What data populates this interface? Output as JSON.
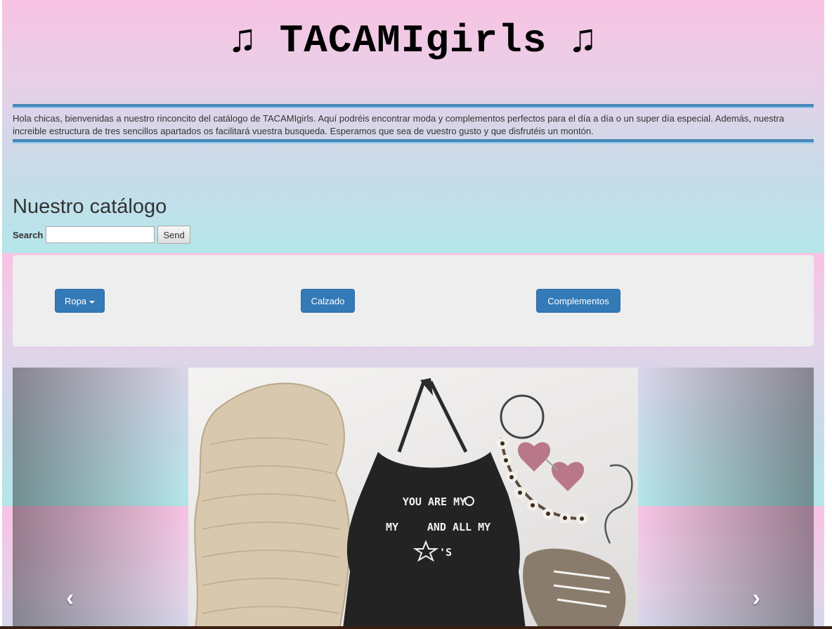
{
  "header": {
    "title": "♫ TACAMIgirls ♫"
  },
  "intro": {
    "text": "Hola chicas, bienvenidas a nuestro rinconcito del catálogo de TACAMIgirls. Aquí podréis encontrar moda y complementos perfectos para el día a día o un super día especial. Además, nuestra increible estructura de tres sencillos apartados os facilitará vuestra busqueda. Esperamos que sea de vuestro gusto y que disfrutéis un montón."
  },
  "catalog": {
    "heading": "Nuestro catálogo"
  },
  "search": {
    "label": "Search",
    "value": "",
    "button": "Send"
  },
  "nav": {
    "items": [
      {
        "label": "Ropa",
        "dropdown": true
      },
      {
        "label": "Calzado",
        "dropdown": false
      },
      {
        "label": "Complementos",
        "dropdown": false
      }
    ],
    "button_color": "#337ab7"
  },
  "carousel": {
    "prev_icon": "chevron-left-icon",
    "next_icon": "chevron-right-icon",
    "slide_shirt_lines": [
      "YOU ARE MY",
      "MY",
      "AND ALL MY",
      "'S"
    ],
    "prev_glyph": "‹",
    "next_glyph": "›"
  }
}
